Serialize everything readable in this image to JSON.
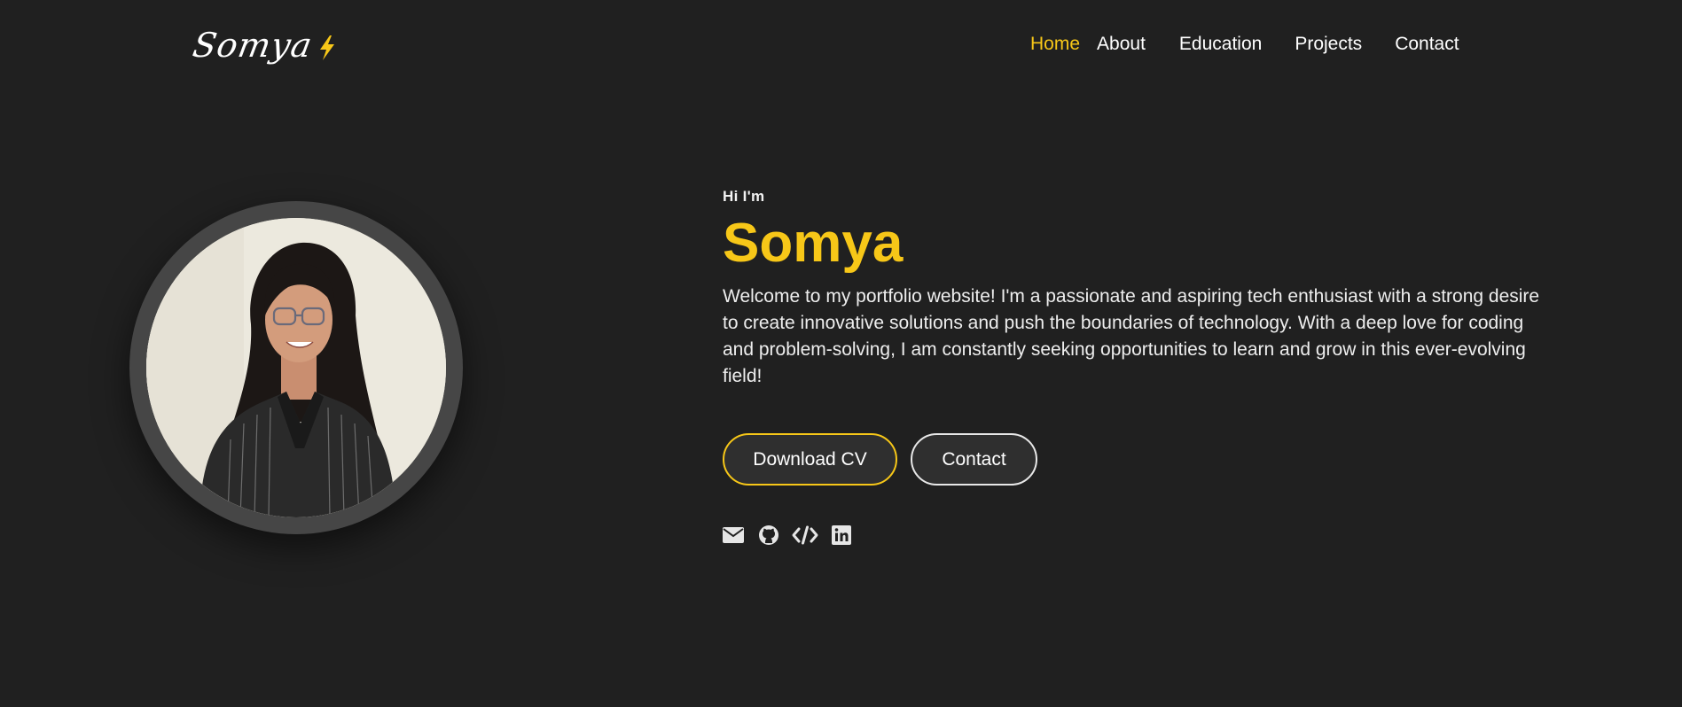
{
  "header": {
    "logo_text": "Somya",
    "nav": [
      {
        "label": "Home",
        "active": true
      },
      {
        "label": "About",
        "active": false
      },
      {
        "label": "Education",
        "active": false
      },
      {
        "label": "Projects",
        "active": false
      },
      {
        "label": "Contact",
        "active": false
      }
    ]
  },
  "hero": {
    "greeting": "Hi I'm",
    "name": "Somya",
    "intro": "Welcome to my portfolio website! I'm a passionate and aspiring tech enthusiast with a strong desire to create innovative solutions and push the boundaries of technology. With a deep love for coding and problem-solving, I am constantly seeking opportunities to learn and grow in this ever-evolving field!",
    "buttons": {
      "download_cv": "Download CV",
      "contact": "Contact"
    }
  },
  "socials": [
    "email-icon",
    "github-icon",
    "code-icon",
    "linkedin-icon"
  ],
  "colors": {
    "background": "#202020",
    "accent": "#f7c718",
    "text": "#ffffff",
    "ring": "#464646",
    "button_bg": "#2f2f2f"
  }
}
